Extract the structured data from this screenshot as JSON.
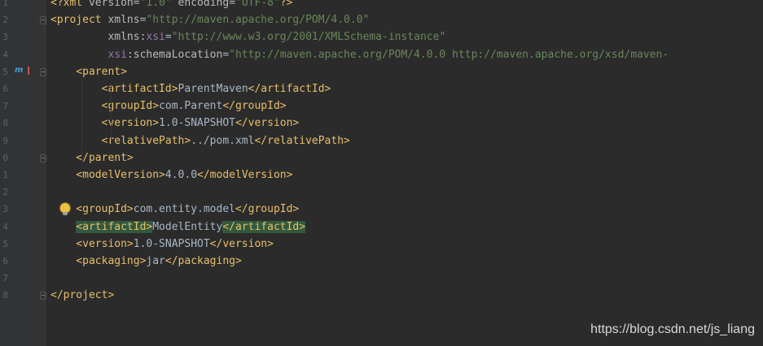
{
  "editor": {
    "lines": [
      {
        "num": "1",
        "segs": [
          [
            "tag",
            "<?xml "
          ],
          [
            "attr",
            "version"
          ],
          [
            "txt",
            "="
          ],
          [
            "val",
            "\"1.0\""
          ],
          [
            "attr",
            " encoding"
          ],
          [
            "txt",
            "="
          ],
          [
            "val",
            "\"UTF-8\""
          ],
          [
            "tag",
            "?>"
          ]
        ]
      },
      {
        "num": "2",
        "segs": [
          [
            "tag",
            "<project "
          ],
          [
            "attr",
            "xmlns"
          ],
          [
            "txt",
            "="
          ],
          [
            "val",
            "\"http://maven.apache.org/POM/4.0.0\""
          ]
        ]
      },
      {
        "num": "3",
        "segs": [
          [
            "attr",
            "         xmlns:"
          ],
          [
            "ns",
            "xsi"
          ],
          [
            "txt",
            "="
          ],
          [
            "val",
            "\"http://www.w3.org/2001/XMLSchema-instance\""
          ]
        ]
      },
      {
        "num": "4",
        "segs": [
          [
            "ns",
            "         xsi"
          ],
          [
            "attr",
            ":schemaLocation"
          ],
          [
            "txt",
            "="
          ],
          [
            "val",
            "\"http://maven.apache.org/POM/4.0.0 http://maven.apache.org/xsd/maven-"
          ]
        ]
      },
      {
        "num": "5",
        "segs": [
          [
            "tag",
            "    <parent>"
          ]
        ]
      },
      {
        "num": "6",
        "segs": [
          [
            "tag",
            "        <artifactId>"
          ],
          [
            "txt",
            "ParentMaven"
          ],
          [
            "tag",
            "</artifactId>"
          ]
        ]
      },
      {
        "num": "7",
        "segs": [
          [
            "tag",
            "        <groupId>"
          ],
          [
            "txt",
            "com.Parent"
          ],
          [
            "tag",
            "</groupId>"
          ]
        ]
      },
      {
        "num": "8",
        "segs": [
          [
            "tag",
            "        <version>"
          ],
          [
            "txt",
            "1.0-SNAPSHOT"
          ],
          [
            "tag",
            "</version>"
          ]
        ]
      },
      {
        "num": "9",
        "segs": [
          [
            "tag",
            "        <relativePath>"
          ],
          [
            "txt",
            "../pom.xml"
          ],
          [
            "tag",
            "</relativePath>"
          ]
        ]
      },
      {
        "num": "0",
        "segs": [
          [
            "tag",
            "    </parent>"
          ]
        ]
      },
      {
        "num": "1",
        "segs": [
          [
            "tag",
            "    <modelVersion>"
          ],
          [
            "txt",
            "4.0.0"
          ],
          [
            "tag",
            "</modelVersion>"
          ]
        ]
      },
      {
        "num": "2",
        "segs": []
      },
      {
        "num": "3",
        "segs": [
          [
            "tag",
            "    <groupId>"
          ],
          [
            "txt",
            "com.entity.model"
          ],
          [
            "tag",
            "</groupId>"
          ]
        ]
      },
      {
        "num": "4",
        "segs": [
          [
            "txt",
            "    "
          ],
          [
            "hl",
            "<artifactId>"
          ],
          [
            "txt",
            "ModelEntity"
          ],
          [
            "hl",
            "</artifactId>"
          ]
        ]
      },
      {
        "num": "5",
        "segs": [
          [
            "tag",
            "    <version>"
          ],
          [
            "txt",
            "1.0-SNAPSHOT"
          ],
          [
            "tag",
            "</version>"
          ]
        ]
      },
      {
        "num": "6",
        "segs": [
          [
            "tag",
            "    <packaging>"
          ],
          [
            "txt",
            "jar"
          ],
          [
            "tag",
            "</packaging>"
          ]
        ]
      },
      {
        "num": "7",
        "segs": []
      },
      {
        "num": "8",
        "segs": [
          [
            "tag",
            "</project>"
          ]
        ]
      }
    ]
  },
  "gutter": {
    "icons": [
      "maven-icon",
      "lightbulb-icon"
    ]
  },
  "watermark": "https://blog.csdn.net/js_liang",
  "colors": {
    "background": "#2b2b2b",
    "tag": "#e8bf6a",
    "attribute": "#bababa",
    "namespace": "#9876aa",
    "string": "#6a8759",
    "text": "#a9b7c6",
    "highlight": "#32593d"
  }
}
